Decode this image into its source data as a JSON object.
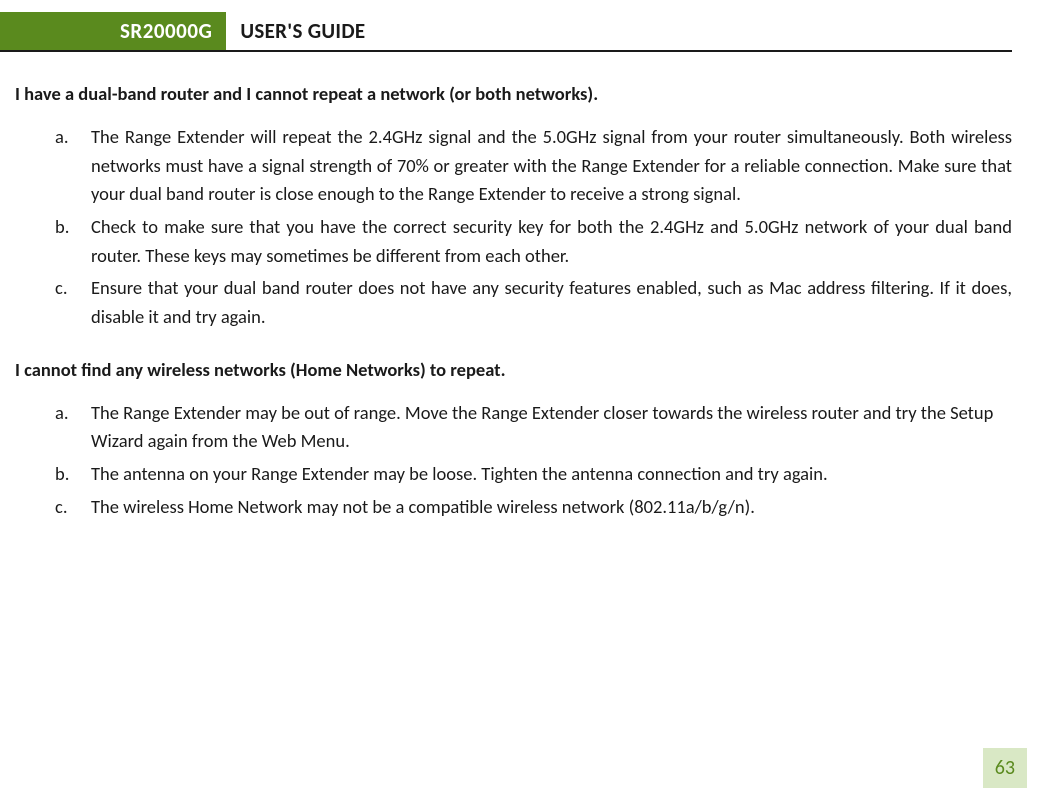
{
  "header": {
    "product_model": "SR20000G",
    "doc_title": "USER'S GUIDE"
  },
  "sections": [
    {
      "heading": "I have a dual-band router and I cannot repeat a network (or both networks).",
      "items": [
        {
          "marker": "a.",
          "text": "The Range Extender will repeat the 2.4GHz signal and the 5.0GHz signal from your router simultaneously. Both wireless networks must have a signal strength of 70% or greater with the Range Extender for a reliable connection. Make sure that your dual band router is close enough to the Range Extender to receive a strong signal.",
          "justify": true
        },
        {
          "marker": "b.",
          "text": "Check to make sure that you have the correct security key for both the 2.4GHz and 5.0GHz network of your dual band router. These keys may sometimes be different from each other.",
          "justify": true
        },
        {
          "marker": "c.",
          "text": "Ensure that your dual band router does not have any security features enabled, such as Mac address filtering. If it does, disable it and try again.",
          "justify": true
        }
      ]
    },
    {
      "heading": "I cannot find any wireless networks (Home Networks) to repeat.",
      "items": [
        {
          "marker": "a.",
          "text": "The Range Extender may be out of range. Move the Range Extender closer towards the wireless router and try the Setup Wizard again from the Web Menu.",
          "justify": false
        },
        {
          "marker": "b.",
          "text": "The antenna on your Range Extender may be loose. Tighten the antenna connection and try again.",
          "justify": false
        },
        {
          "marker": "c.",
          "text": "The wireless Home Network may not be a compatible wireless network (802.11a/b/g/n).",
          "justify": false
        }
      ]
    }
  ],
  "page_number": "63"
}
